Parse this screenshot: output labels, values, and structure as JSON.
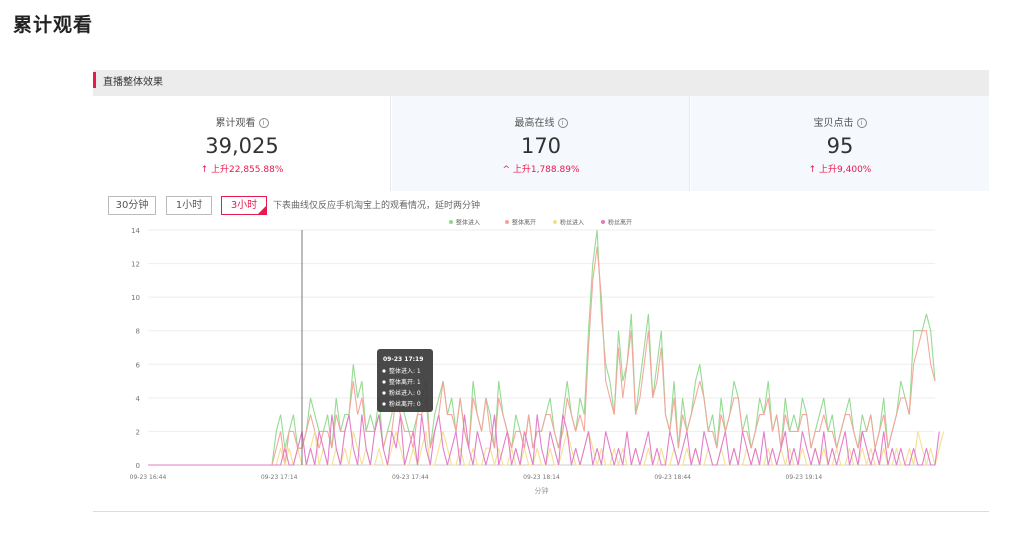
{
  "page": {
    "title": "累计观看"
  },
  "panel": {
    "title": "直播整体效果"
  },
  "stats": [
    {
      "label": "累计观看",
      "value": "39,025",
      "change": "↑ 上升22,855.88%",
      "info_icon": "info-icon"
    },
    {
      "label": "最高在线",
      "value": "170",
      "change": "^ 上升1,788.89%",
      "info_icon": "info-icon"
    },
    {
      "label": "宝贝点击",
      "value": "95",
      "change": "↑ 上升9,400%",
      "info_icon": "info-icon"
    }
  ],
  "tabs": [
    {
      "label": "30分钟",
      "active": false
    },
    {
      "label": "1小时",
      "active": false
    },
    {
      "label": "3小时",
      "active": true
    }
  ],
  "hint": "下表曲线仅反应手机淘宝上的观看情况，延时两分钟",
  "colors": {
    "accent": "#e8194d",
    "green": "#8fd98c",
    "salmon": "#f4a39a",
    "yellow": "#f2df8a",
    "pink": "#e277c8"
  },
  "chart_data": {
    "type": "line",
    "xlabel": "分钟",
    "ylabel": "",
    "ylim": [
      0,
      14
    ],
    "yticks": [
      "0",
      "2",
      "4",
      "6",
      "8",
      "10",
      "12",
      "14"
    ],
    "xticks": [
      "09-23 16:44",
      "09-23 17:14",
      "09-23 17:44",
      "09-23 18:14",
      "09-23 18:44",
      "09-23 19:14"
    ],
    "legend_position": "top",
    "grid": true,
    "series": [
      {
        "name": "整体进入",
        "color": "#8fd98c",
        "values": [
          0,
          0,
          0,
          0,
          0,
          0,
          0,
          0,
          0,
          0,
          0,
          0,
          0,
          0,
          0,
          0,
          0,
          0,
          0,
          0,
          0,
          0,
          0,
          0,
          0,
          0,
          0,
          0,
          0,
          0,
          2,
          3,
          1,
          2,
          3,
          1,
          1,
          2,
          4,
          3,
          2,
          2,
          3,
          1,
          4,
          2,
          3,
          3,
          6,
          4,
          5,
          2,
          3,
          2,
          4,
          1,
          2,
          3,
          5,
          4,
          3,
          2,
          2,
          3,
          4,
          5,
          1,
          3,
          4,
          5,
          3,
          4,
          2,
          4,
          2,
          1,
          5,
          3,
          2,
          4,
          3,
          1,
          5,
          3,
          2,
          1,
          3,
          2,
          1,
          3,
          1,
          2,
          2,
          3,
          4,
          2,
          1,
          3,
          5,
          3,
          2,
          4,
          3,
          8,
          12,
          14,
          9,
          6,
          5,
          3,
          8,
          5,
          6,
          9,
          3,
          5,
          7,
          9,
          4,
          6,
          8,
          3,
          2,
          5,
          1,
          4,
          2,
          3,
          5,
          6,
          4,
          2,
          3,
          1,
          4,
          2,
          3,
          5,
          4,
          2,
          3,
          1,
          2,
          4,
          3,
          5,
          2,
          3,
          1,
          4,
          2,
          3,
          2,
          4,
          3,
          1,
          2,
          3,
          4,
          2,
          3,
          1,
          2,
          3,
          4,
          2,
          1,
          3,
          2,
          3,
          1,
          2,
          4,
          1,
          2,
          3,
          5,
          4,
          3,
          8,
          8,
          8,
          9,
          8,
          5
        ]
      },
      {
        "name": "整体离开",
        "color": "#f4a39a",
        "values": [
          0,
          0,
          0,
          0,
          0,
          0,
          0,
          0,
          0,
          0,
          0,
          0,
          0,
          0,
          0,
          0,
          0,
          0,
          0,
          0,
          0,
          0,
          0,
          0,
          0,
          0,
          0,
          0,
          0,
          0,
          1,
          2,
          0,
          2,
          2,
          1,
          1,
          2,
          3,
          2,
          1,
          2,
          2,
          1,
          3,
          2,
          2,
          3,
          5,
          3,
          4,
          2,
          2,
          2,
          3,
          1,
          2,
          2,
          4,
          3,
          2,
          2,
          1,
          3,
          3,
          4,
          1,
          2,
          3,
          5,
          3,
          3,
          2,
          4,
          2,
          1,
          4,
          3,
          2,
          4,
          2,
          1,
          4,
          3,
          2,
          1,
          2,
          2,
          1,
          3,
          1,
          2,
          2,
          3,
          3,
          2,
          1,
          2,
          4,
          3,
          2,
          3,
          2,
          7,
          11,
          13,
          10,
          5,
          4,
          3,
          7,
          4,
          6,
          8,
          3,
          4,
          6,
          8,
          4,
          5,
          7,
          3,
          2,
          4,
          1,
          3,
          2,
          3,
          4,
          5,
          4,
          2,
          2,
          1,
          3,
          2,
          3,
          4,
          4,
          2,
          2,
          1,
          2,
          3,
          3,
          4,
          2,
          3,
          1,
          3,
          2,
          2,
          2,
          3,
          3,
          1,
          2,
          2,
          3,
          2,
          2,
          1,
          2,
          3,
          3,
          2,
          1,
          2,
          2,
          3,
          1,
          2,
          3,
          1,
          2,
          3,
          4,
          4,
          3,
          6,
          7,
          8,
          8,
          6,
          5
        ]
      },
      {
        "name": "粉丝进入",
        "color": "#f2df8a",
        "values": [
          0,
          0,
          0,
          0,
          0,
          0,
          0,
          0,
          0,
          0,
          0,
          0,
          0,
          0,
          0,
          0,
          0,
          0,
          0,
          0,
          0,
          0,
          0,
          0,
          0,
          0,
          0,
          0,
          0,
          0,
          0,
          1,
          0,
          1,
          0,
          1,
          0,
          0,
          1,
          2,
          0,
          1,
          0,
          0,
          1,
          0,
          1,
          0,
          2,
          1,
          0,
          1,
          0,
          0,
          1,
          0,
          0,
          1,
          2,
          1,
          0,
          0,
          1,
          0,
          1,
          2,
          0,
          0,
          1,
          2,
          1,
          0,
          0,
          1,
          0,
          0,
          1,
          0,
          0,
          1,
          1,
          0,
          1,
          0,
          0,
          1,
          0,
          0,
          1,
          0,
          0,
          1,
          0,
          0,
          1,
          0,
          0,
          1,
          2,
          1,
          0,
          0,
          1,
          2,
          1,
          0,
          1,
          0,
          0,
          1,
          0,
          1,
          0,
          0,
          1,
          0,
          0,
          1,
          0,
          0,
          1,
          0,
          0,
          1,
          0,
          0,
          1,
          0,
          1,
          0,
          0,
          1,
          0,
          0,
          1,
          0,
          0,
          1,
          0,
          0,
          1,
          0,
          1,
          0,
          0,
          1,
          0,
          0,
          1,
          0,
          1,
          0,
          0,
          1,
          0,
          0,
          1,
          0,
          1,
          0,
          0,
          1,
          0,
          0,
          1,
          0,
          0,
          1,
          0,
          1,
          0,
          0,
          1,
          0,
          0,
          1,
          0,
          0,
          1,
          0,
          2,
          1,
          0,
          1,
          0,
          1,
          2
        ]
      },
      {
        "name": "粉丝离开",
        "color": "#e277c8",
        "values": [
          0,
          0,
          0,
          0,
          0,
          0,
          0,
          0,
          0,
          0,
          0,
          0,
          0,
          0,
          0,
          0,
          0,
          0,
          0,
          0,
          0,
          0,
          0,
          0,
          0,
          0,
          0,
          0,
          0,
          0,
          0,
          0,
          1,
          0,
          0,
          1,
          2,
          0,
          1,
          0,
          2,
          1,
          0,
          3,
          1,
          0,
          2,
          3,
          1,
          0,
          3,
          1,
          0,
          2,
          3,
          1,
          0,
          2,
          1,
          3,
          0,
          1,
          2,
          0,
          3,
          1,
          0,
          2,
          3,
          1,
          0,
          1,
          2,
          0,
          3,
          1,
          0,
          2,
          1,
          0,
          1,
          3,
          0,
          1,
          2,
          0,
          1,
          0,
          2,
          1,
          0,
          3,
          1,
          0,
          2,
          1,
          0,
          3,
          2,
          0,
          1,
          0,
          1,
          2,
          0,
          1,
          0,
          2,
          1,
          0,
          1,
          0,
          2,
          0,
          1,
          0,
          1,
          2,
          0,
          1,
          0,
          0,
          2,
          1,
          0,
          1,
          2,
          0,
          1,
          0,
          2,
          1,
          0,
          0,
          1,
          2,
          0,
          1,
          0,
          2,
          1,
          0,
          1,
          0,
          2,
          0,
          1,
          0,
          1,
          2,
          0,
          1,
          0,
          2,
          1,
          0,
          1,
          0,
          2,
          0,
          1,
          0,
          1,
          2,
          0,
          1,
          0,
          2,
          1,
          0,
          1,
          0,
          2,
          0,
          1,
          0,
          1,
          0,
          0,
          1,
          0,
          0,
          1,
          0,
          0,
          2
        ]
      }
    ],
    "tooltip": {
      "time": "09-23 17:19",
      "rows": [
        {
          "label": "整体进入",
          "value": "1"
        },
        {
          "label": "整体离开",
          "value": "1"
        },
        {
          "label": "粉丝进入",
          "value": "0"
        },
        {
          "label": "粉丝离开",
          "value": "0"
        }
      ]
    }
  }
}
